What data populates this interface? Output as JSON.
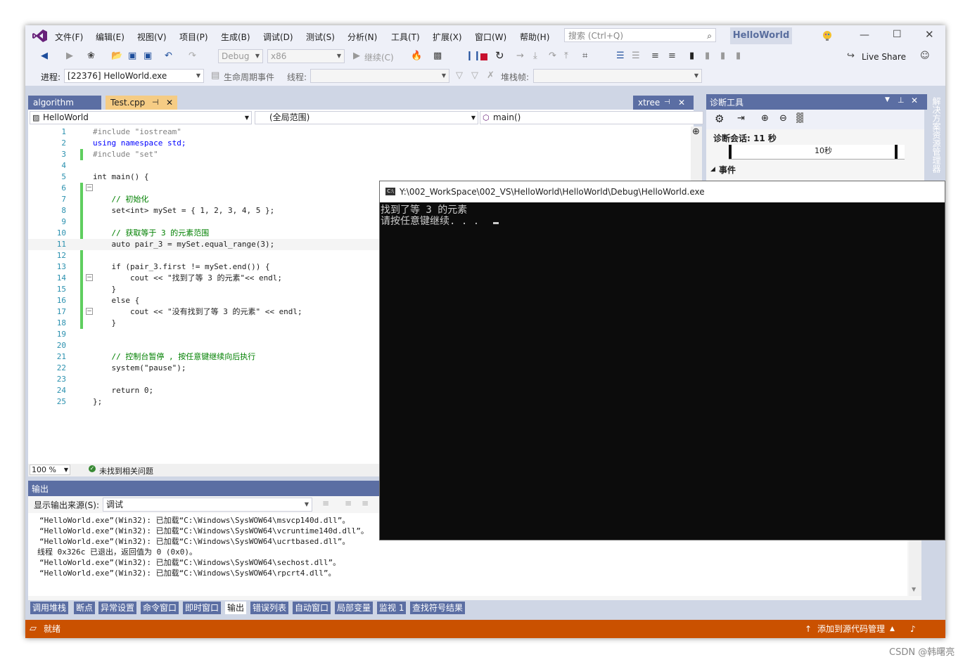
{
  "menu": {
    "items": [
      "文件(F)",
      "编辑(E)",
      "视图(V)",
      "项目(P)",
      "生成(B)",
      "调试(D)",
      "测试(S)",
      "分析(N)",
      "工具(T)",
      "扩展(X)",
      "窗口(W)",
      "帮助(H)"
    ],
    "search_placeholder": "搜索 (Ctrl+Q)",
    "app_name": "HelloWorld"
  },
  "toolbar": {
    "config": "Debug",
    "platform": "x86",
    "continue_label": "继续(C)",
    "live_share": "Live Share"
  },
  "debugbar": {
    "process_label": "进程:",
    "process_value": "[22376] HelloWorld.exe",
    "lifecycle_label": "生命周期事件",
    "thread_label": "线程:",
    "stackframe_label": "堆栈帧:"
  },
  "tabs": {
    "algorithm": "algorithm",
    "test_cpp": "Test.cpp",
    "xtree": "xtree"
  },
  "editor": {
    "project": "HelloWorld",
    "scope": "(全局范围)",
    "member": "main()",
    "zoom": "100 %",
    "issues": "未找到相关问题",
    "lines": [
      {
        "n": "1",
        "t": "#include \"iostream\""
      },
      {
        "n": "2",
        "t": "using namespace std;"
      },
      {
        "n": "3",
        "t": "#include \"set\""
      },
      {
        "n": "4",
        "t": ""
      },
      {
        "n": "5",
        "t": "int main() {"
      },
      {
        "n": "6",
        "t": ""
      },
      {
        "n": "7",
        "t": "    // 初始化"
      },
      {
        "n": "8",
        "t": "    set<int> mySet = { 1, 2, 3, 4, 5 };"
      },
      {
        "n": "9",
        "t": ""
      },
      {
        "n": "10",
        "t": "    // 获取等于 3 的元素范围"
      },
      {
        "n": "11",
        "t": "    auto pair_3 = mySet.equal_range(3);"
      },
      {
        "n": "12",
        "t": ""
      },
      {
        "n": "13",
        "t": "    if (pair_3.first != mySet.end()) {"
      },
      {
        "n": "14",
        "t": "        cout << \"找到了等 3 的元素\"<< endl;"
      },
      {
        "n": "15",
        "t": "    }"
      },
      {
        "n": "16",
        "t": "    else {"
      },
      {
        "n": "17",
        "t": "        cout << \"没有找到了等 3 的元素\" << endl;"
      },
      {
        "n": "18",
        "t": "    }"
      },
      {
        "n": "19",
        "t": ""
      },
      {
        "n": "20",
        "t": ""
      },
      {
        "n": "21",
        "t": "    // 控制台暂停 , 按任意键继续向后执行"
      },
      {
        "n": "22",
        "t": "    system(\"pause\");"
      },
      {
        "n": "23",
        "t": ""
      },
      {
        "n": "24",
        "t": "    return 0;"
      },
      {
        "n": "25",
        "t": "};"
      }
    ]
  },
  "diagnostics": {
    "title": "诊断工具",
    "session": "诊断会话: 11 秒",
    "tick": "10秒",
    "events": "事件"
  },
  "console": {
    "title": "Y:\\002_WorkSpace\\002_VS\\HelloWorld\\HelloWorld\\Debug\\HelloWorld.exe",
    "line1": "找到了等 3 的元素",
    "line2": "请按任意键继续. . . "
  },
  "output": {
    "title": "输出",
    "source_label": "显示输出来源(S):",
    "source_value": "调试",
    "lines": [
      "“HelloWorld.exe”(Win32): 已加载“C:\\Windows\\SysWOW64\\msvcp140d.dll”。",
      "“HelloWorld.exe”(Win32): 已加载“C:\\Windows\\SysWOW64\\vcruntime140d.dll”。",
      "“HelloWorld.exe”(Win32): 已加载“C:\\Windows\\SysWOW64\\ucrtbased.dll”。",
      "线程 0x326c 已退出，返回值为 0 (0x0)。",
      "“HelloWorld.exe”(Win32): 已加载“C:\\Windows\\SysWOW64\\sechost.dll”。",
      "“HelloWorld.exe”(Win32): 已加载“C:\\Windows\\SysWOW64\\rpcrt4.dll”。"
    ]
  },
  "bottom_tabs": [
    "调用堆栈",
    "断点",
    "异常设置",
    "命令窗口",
    "即时窗口",
    "输出",
    "错误列表",
    "自动窗口",
    "局部变量",
    "监视 1",
    "查找符号结果"
  ],
  "status": {
    "ready": "就绪",
    "source_control": "添加到源代码管理"
  },
  "side_panel": "解决方案资源管理器",
  "watermark": "CSDN @韩曙亮",
  "colors": {
    "accent": "#007acc",
    "status": "#ca5100",
    "vs_purple": "#68217a"
  }
}
